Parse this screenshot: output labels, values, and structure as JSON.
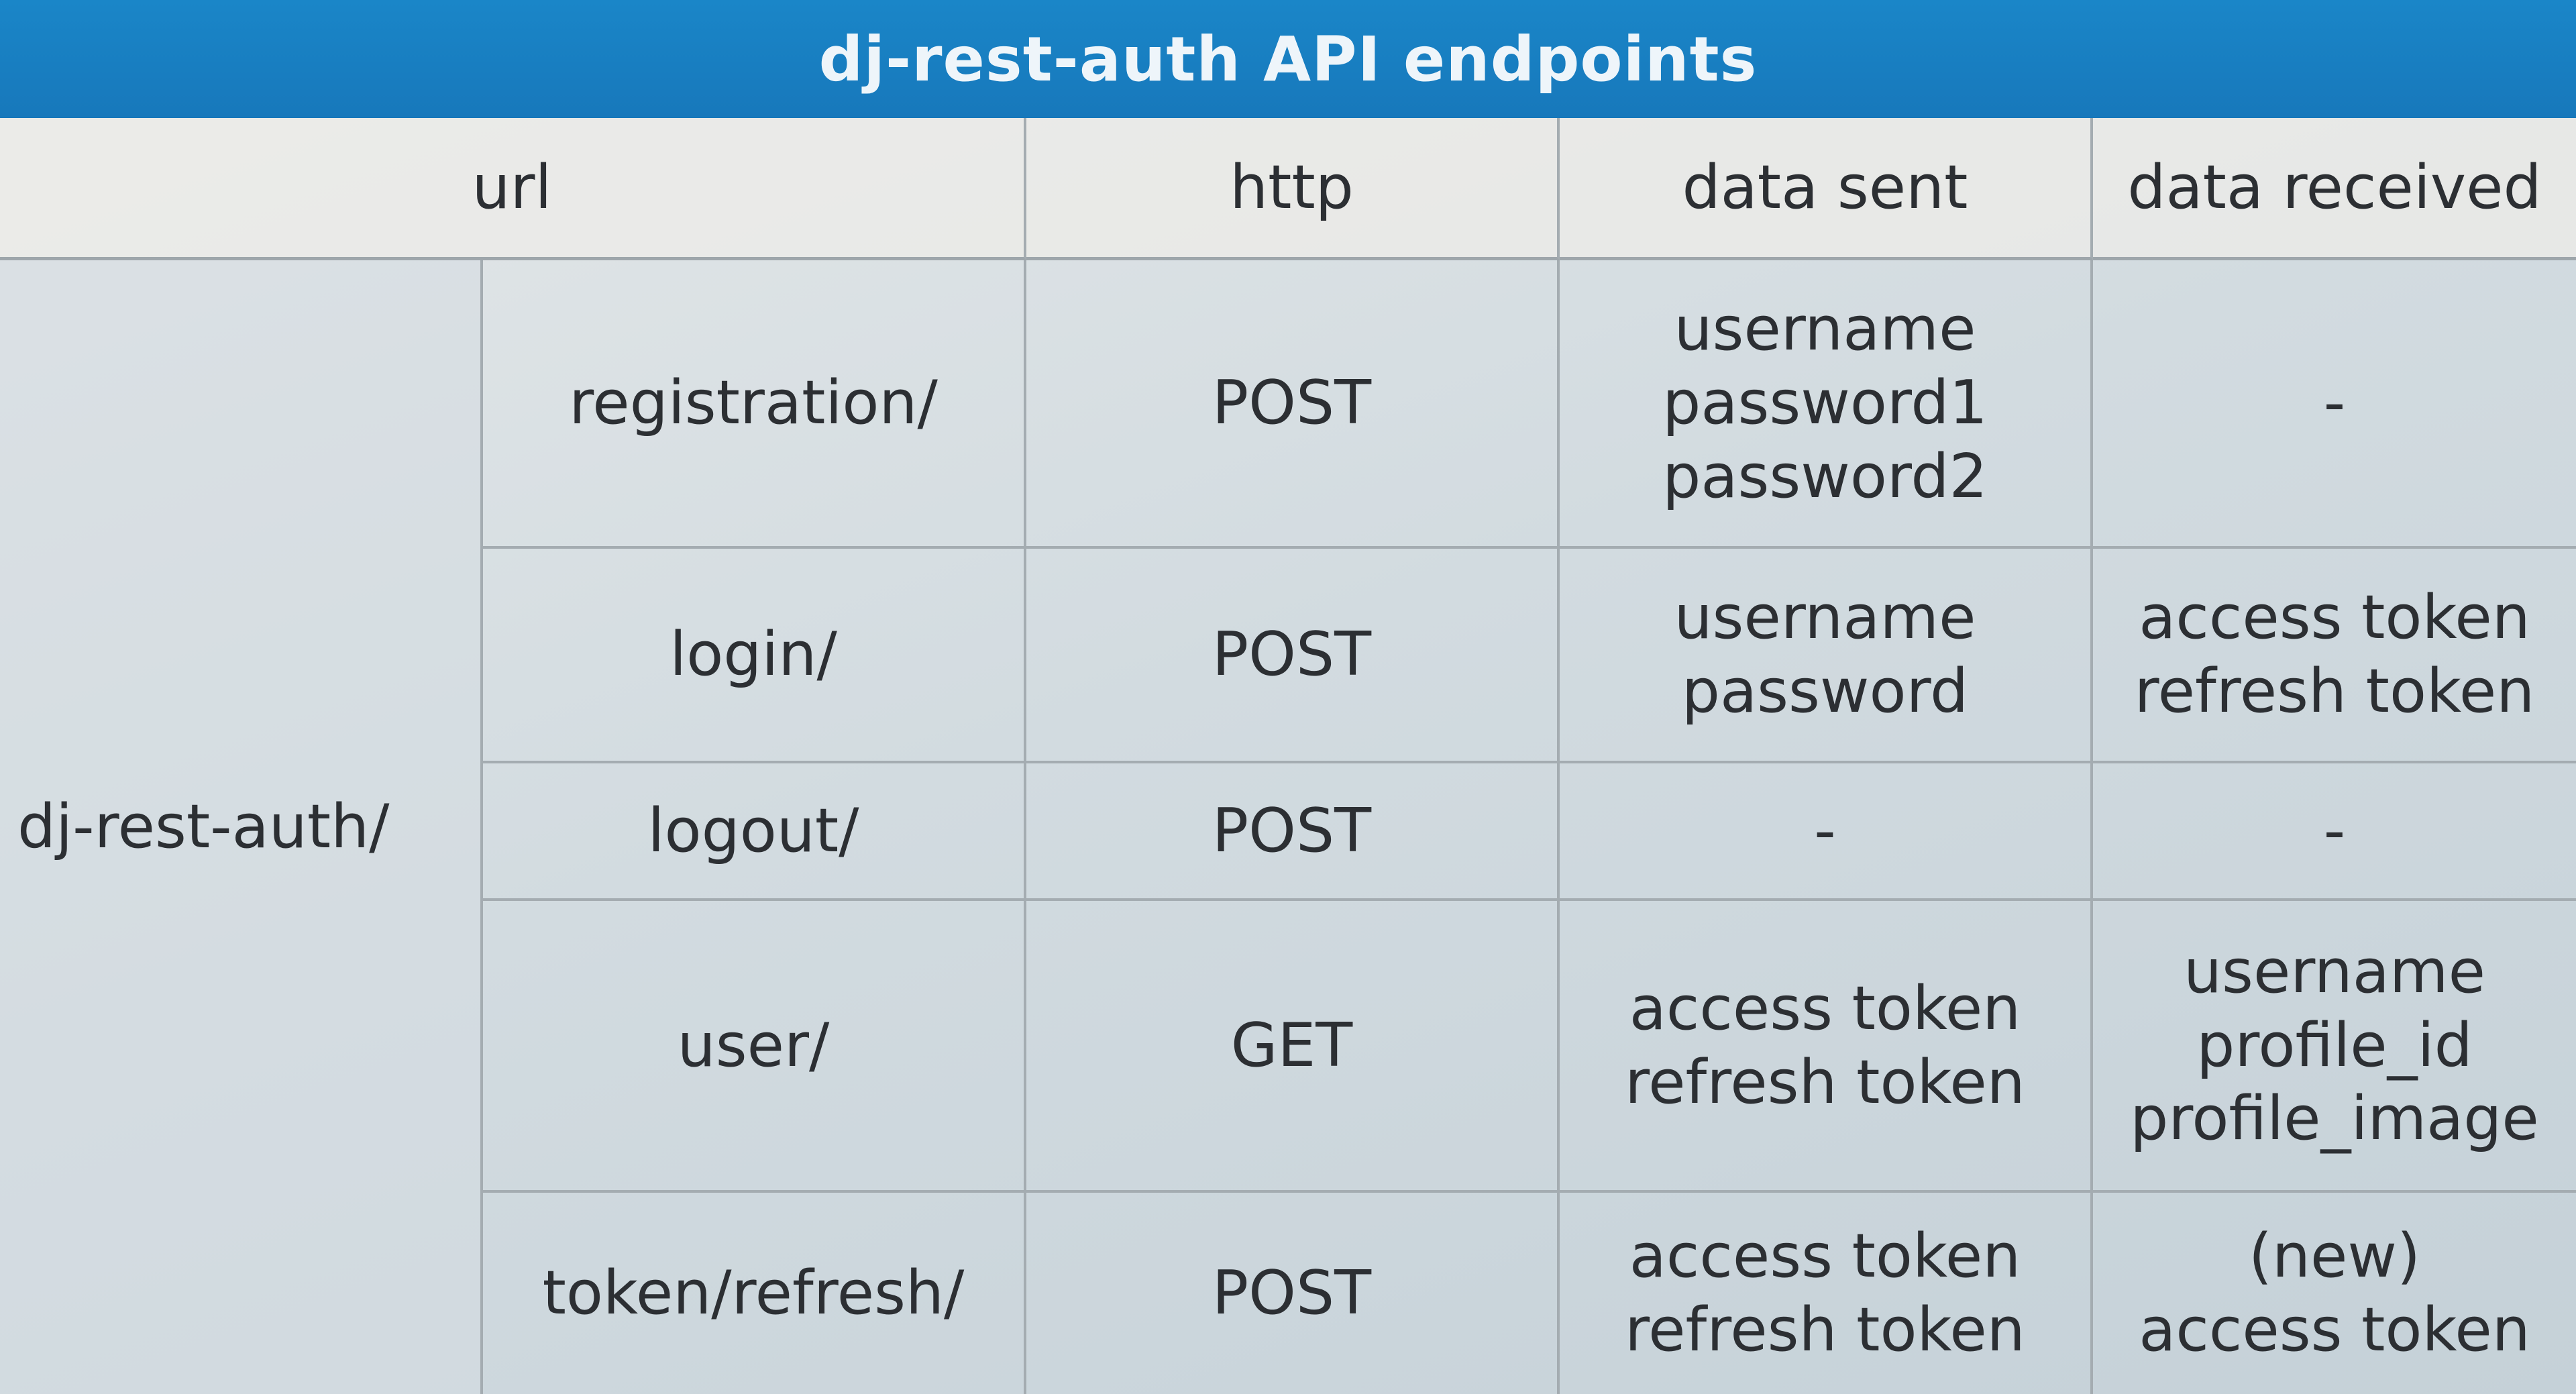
{
  "title": "dj-rest-auth API endpoints",
  "columns": {
    "url": "url",
    "http": "http",
    "data_sent": "data sent",
    "data_received": "data received"
  },
  "url_prefix": "dj-rest-auth/",
  "rows": [
    {
      "path": "registration/",
      "method": "POST",
      "sent": [
        "username",
        "password1",
        "password2"
      ],
      "received": [
        "-"
      ]
    },
    {
      "path": "login/",
      "method": "POST",
      "sent": [
        "username",
        "password"
      ],
      "received": [
        "access token",
        "refresh token"
      ]
    },
    {
      "path": "logout/",
      "method": "POST",
      "sent": [
        "-"
      ],
      "received": [
        "-"
      ]
    },
    {
      "path": "user/",
      "method": "GET",
      "sent": [
        "access token",
        "refresh token"
      ],
      "received": [
        "username",
        "profile_id",
        "profile_image"
      ]
    },
    {
      "path": "token/refresh/",
      "method": "POST",
      "sent": [
        "access token",
        "refresh token"
      ],
      "received": [
        "(new)",
        "access token"
      ]
    }
  ]
}
